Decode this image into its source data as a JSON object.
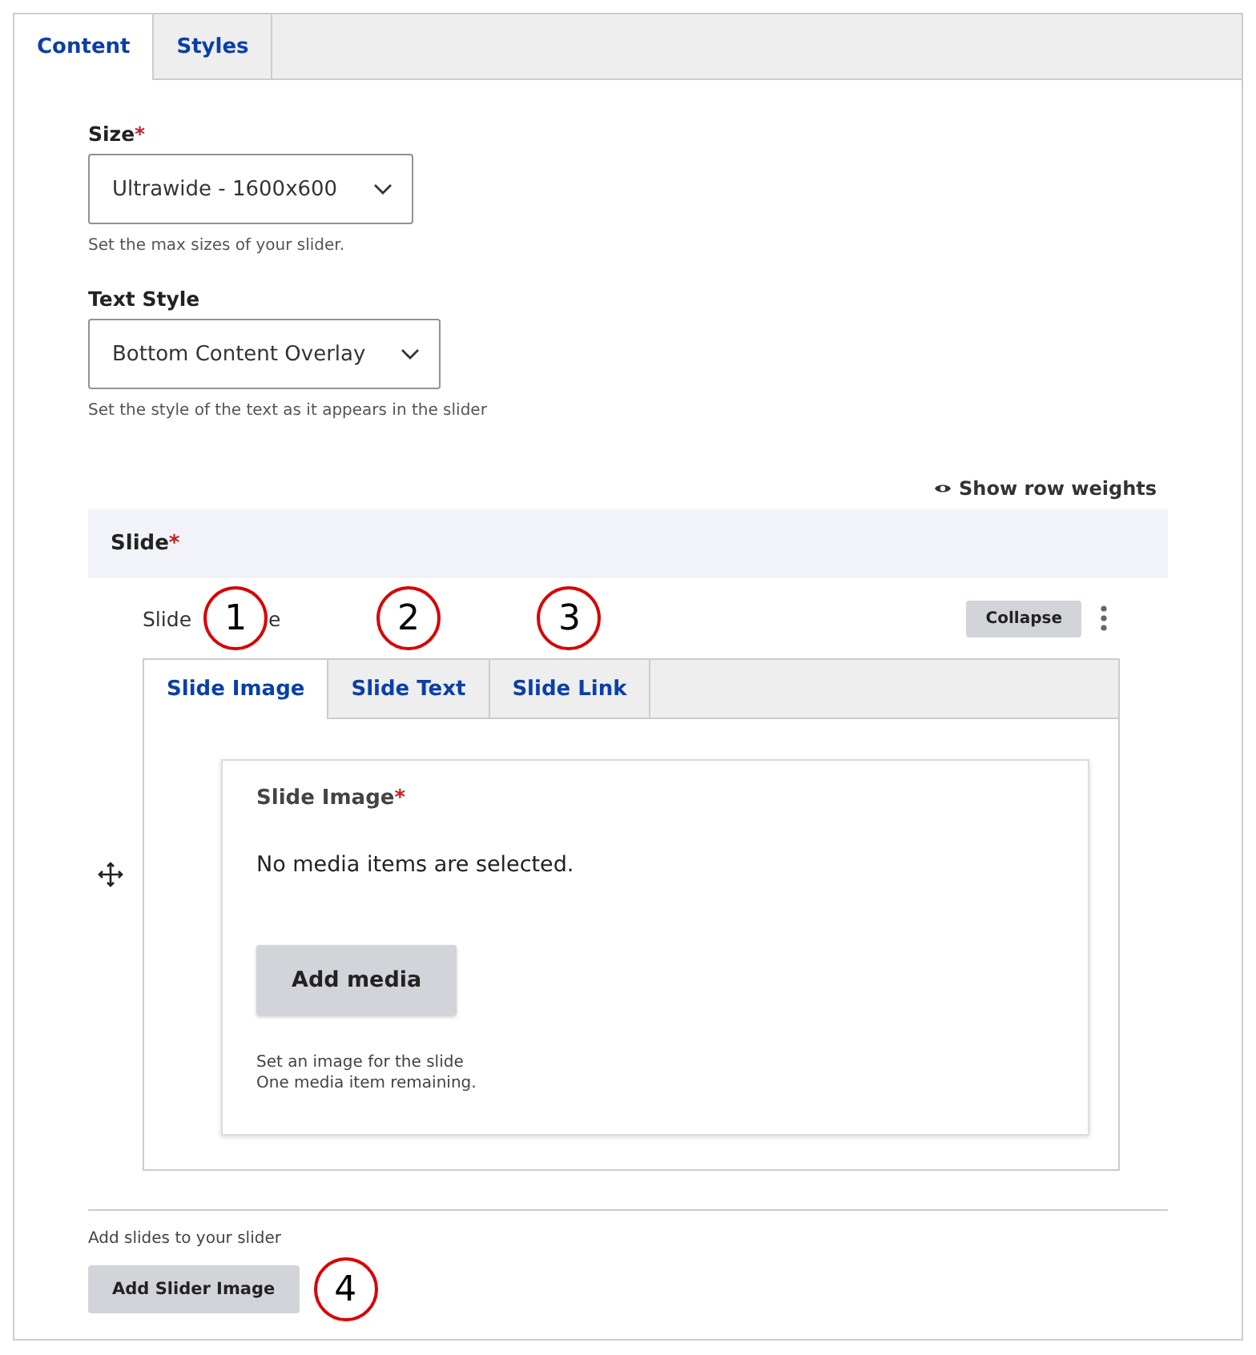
{
  "tabs": [
    {
      "label": "Content",
      "selected": true
    },
    {
      "label": "Styles",
      "selected": false
    }
  ],
  "fields": [
    {
      "label": "Size",
      "required_mark": "*",
      "value": "Ultrawide - 1600x600",
      "description": "Set the max sizes of your slider."
    },
    {
      "label": "Text Style",
      "value": "Bottom Content Overlay",
      "description": "Set the style of the text as it appears in the slider"
    }
  ],
  "row_weights_link": "Show row weights",
  "slide_section": {
    "title": "Slide",
    "required_mark": "*",
    "item": {
      "label_parts": [
        "Slide",
        "e"
      ],
      "collapse_button": "Collapse",
      "tabs": [
        {
          "label": "Slide Image",
          "selected": true,
          "callout": "1"
        },
        {
          "label": "Slide Text",
          "selected": false,
          "callout": "2"
        },
        {
          "label": "Slide Link",
          "selected": false,
          "callout": "3"
        }
      ],
      "panel": {
        "title": "Slide Image",
        "required_mark": "*",
        "empty_message": "No media items are selected.",
        "button": "Add media",
        "descriptions": [
          "Set an image for the slide",
          "One media item remaining."
        ]
      }
    }
  },
  "footer": {
    "description": "Add slides to your slider",
    "button": "Add Slider Image",
    "callout": "4"
  }
}
